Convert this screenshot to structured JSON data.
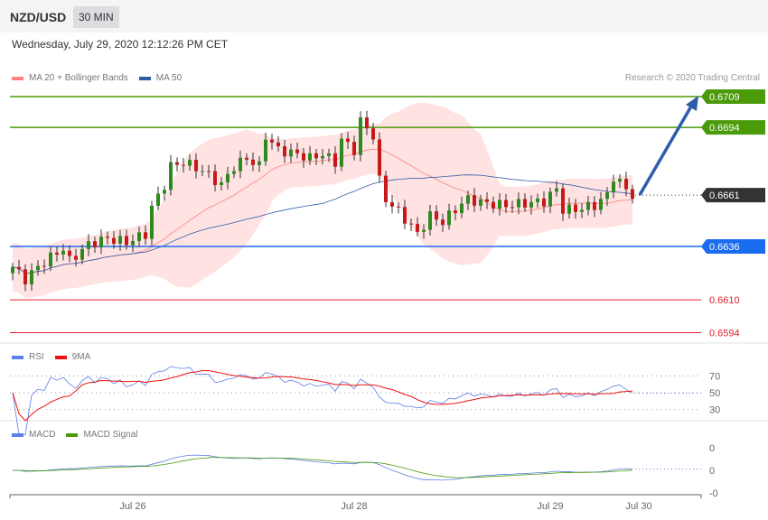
{
  "header": {
    "symbol": "NZD/USD",
    "timeframe": "30 MIN",
    "date": "Wednesday, July 29, 2020 12:12:26 PM CET"
  },
  "legend": {
    "bb": "MA 20 + Bollinger Bands",
    "ma50": "MA 50",
    "rsi": "RSI",
    "rsi_ma": "9MA",
    "macd": "MACD",
    "macd_signal": "MACD Signal"
  },
  "credit": "Research © 2020 Trading Central",
  "colors": {
    "green": "#4a9a0a",
    "blue": "#1a6cf0",
    "red": "#e0202a",
    "current": "#333333",
    "bb": "#ff8080",
    "ma50": "#2e5ea8"
  },
  "chart_data": {
    "type": "candlestick",
    "price_keypoints": [
      [
        0,
        0.6626
      ],
      [
        2,
        0.662
      ],
      [
        4,
        0.6626
      ],
      [
        7,
        0.6633
      ],
      [
        8,
        0.6635
      ],
      [
        9,
        0.6629
      ],
      [
        12,
        0.6637
      ],
      [
        15,
        0.664
      ],
      [
        18,
        0.6638
      ],
      [
        21,
        0.6642
      ],
      [
        22,
        0.6655
      ],
      [
        24,
        0.6666
      ],
      [
        25,
        0.6675
      ],
      [
        27,
        0.6677
      ],
      [
        30,
        0.6673
      ],
      [
        33,
        0.6666
      ],
      [
        35,
        0.6675
      ],
      [
        37,
        0.6679
      ],
      [
        39,
        0.6675
      ],
      [
        40,
        0.669
      ],
      [
        42,
        0.6683
      ],
      [
        45,
        0.6681
      ],
      [
        47,
        0.6679
      ],
      [
        49,
        0.6681
      ],
      [
        51,
        0.6677
      ],
      [
        52,
        0.6688
      ],
      [
        54,
        0.6683
      ],
      [
        55,
        0.6697
      ],
      [
        57,
        0.669
      ],
      [
        58,
        0.6668
      ],
      [
        59,
        0.6659
      ],
      [
        61,
        0.6653
      ],
      [
        63,
        0.6646
      ],
      [
        64,
        0.6642
      ],
      [
        66,
        0.6651
      ],
      [
        68,
        0.6648
      ],
      [
        69,
        0.6651
      ],
      [
        71,
        0.6657
      ],
      [
        72,
        0.6659
      ],
      [
        75,
        0.6657
      ],
      [
        78,
        0.6656
      ],
      [
        81,
        0.6657
      ],
      [
        84,
        0.6658
      ],
      [
        86,
        0.6664
      ],
      [
        87,
        0.6654
      ],
      [
        89,
        0.6654
      ],
      [
        92,
        0.6656
      ],
      [
        94,
        0.6661
      ],
      [
        95,
        0.667
      ],
      [
        96,
        0.6667
      ],
      [
        97,
        0.6664
      ],
      [
        98,
        0.6661
      ]
    ],
    "levels": [
      {
        "value": "0.6709",
        "kind": "resistance"
      },
      {
        "value": "0.6694",
        "kind": "resistance"
      },
      {
        "value": "0.6661",
        "kind": "current"
      },
      {
        "value": "0.6636",
        "kind": "pivot"
      },
      {
        "value": "0.6610",
        "kind": "support"
      },
      {
        "value": "0.6594",
        "kind": "support"
      }
    ],
    "rsi_ticks": [
      "70",
      "50",
      "30"
    ],
    "macd_ticks": [
      "0",
      "0",
      "-0"
    ],
    "x_ticks": [
      {
        "label": "Jul 26",
        "index": 19
      },
      {
        "label": "Jul 28",
        "index": 54
      },
      {
        "label": "Jul 29",
        "index": 85
      },
      {
        "label": "Jul 30",
        "index": 99
      }
    ],
    "forecast": "up to 0.6709"
  }
}
